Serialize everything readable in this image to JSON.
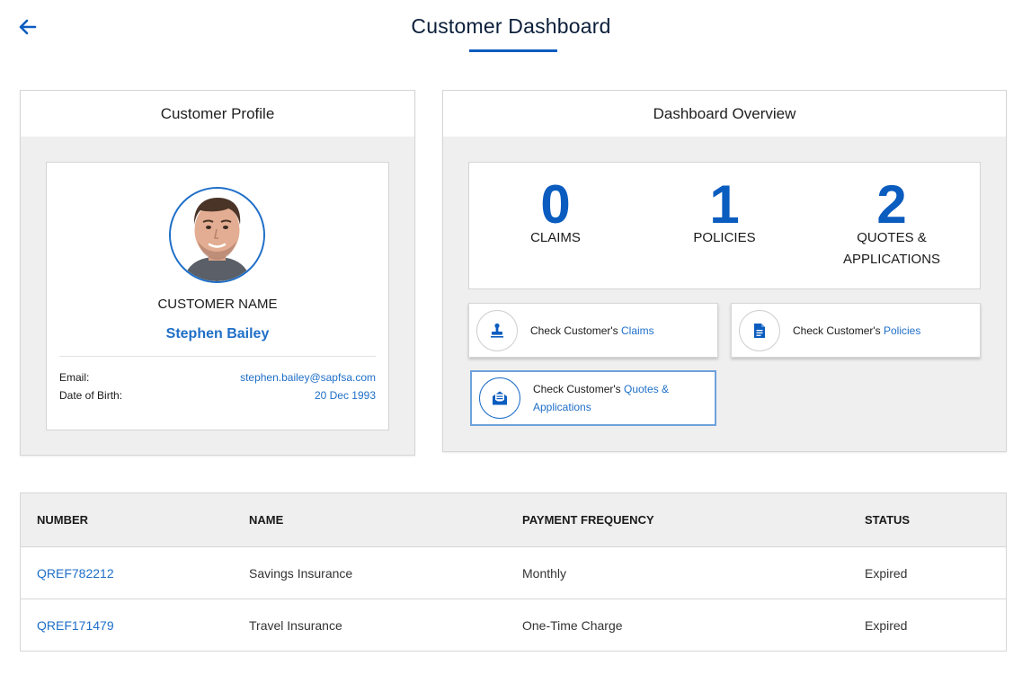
{
  "header": {
    "title": "Customer Dashboard",
    "back_icon": "arrow-left-icon"
  },
  "colors": {
    "brand_blue": "#0b5cbf",
    "link_blue": "#1f6fc8",
    "panel_bg": "#efefef"
  },
  "profile": {
    "panel_title": "Customer Profile",
    "name_label": "CUSTOMER NAME",
    "name": "Stephen Bailey",
    "email_label": "Email:",
    "email": "stephen.bailey@sapfsa.com",
    "dob_label": "Date of Birth:",
    "dob": "20 Dec 1993"
  },
  "overview": {
    "panel_title": "Dashboard Overview",
    "stats": [
      {
        "value": "0",
        "label": "CLAIMS"
      },
      {
        "value": "1",
        "label": "POLICIES"
      },
      {
        "value": "2",
        "label_line1": "QUOTES &",
        "label_line2": "APPLICATIONS"
      }
    ],
    "checks": [
      {
        "prefix": "Check Customer's ",
        "link": "Claims",
        "icon": "stamp-icon"
      },
      {
        "prefix": "Check Customer's ",
        "link": "Policies",
        "icon": "document-icon"
      },
      {
        "prefix": "Check Customer's ",
        "link_line1": "Quotes &",
        "link_line2": "Applications",
        "icon": "envelope-document-icon"
      }
    ]
  },
  "table": {
    "columns": [
      "NUMBER",
      "NAME",
      "PAYMENT FREQUENCY",
      "STATUS"
    ],
    "rows": [
      {
        "number": "QREF782212",
        "name": "Savings Insurance",
        "frequency": "Monthly",
        "status": "Expired"
      },
      {
        "number": "QREF171479",
        "name": "Travel Insurance",
        "frequency": "One-Time Charge",
        "status": "Expired"
      }
    ]
  }
}
